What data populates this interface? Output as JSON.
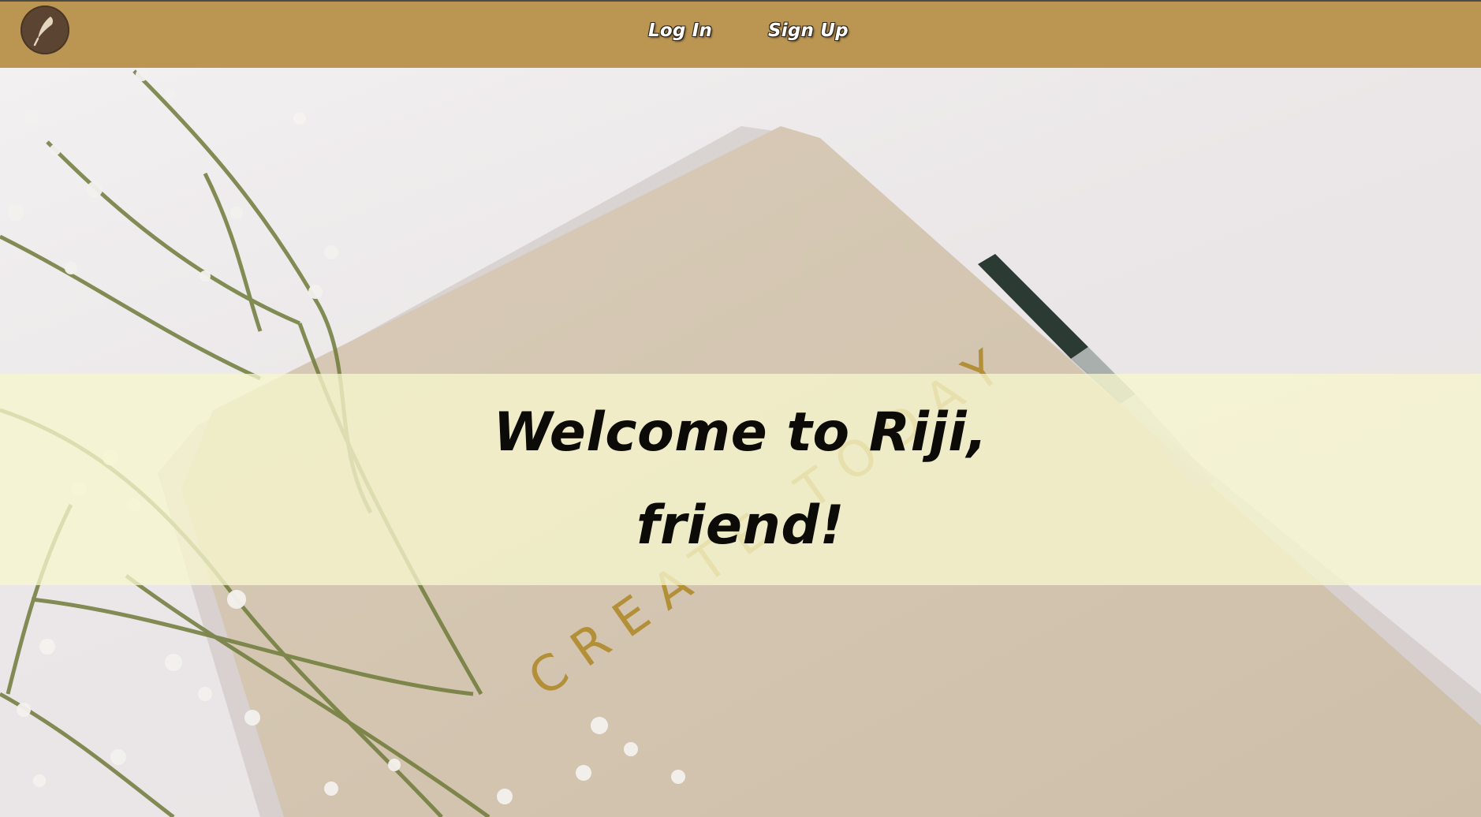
{
  "nav": {
    "login_label": "Log In",
    "signup_label": "Sign Up",
    "logo_icon": "quill-feather-icon"
  },
  "hero": {
    "heading_line1": "Welcome to Riji,",
    "heading_line2": "friend!",
    "background_image_text": "CREATE TODAY"
  },
  "colors": {
    "topbar": "#bb9552",
    "logo_circle": "#5b4532",
    "band": "#f6f6cd",
    "heading": "#0d0b08",
    "nav_text": "#ffffff"
  }
}
